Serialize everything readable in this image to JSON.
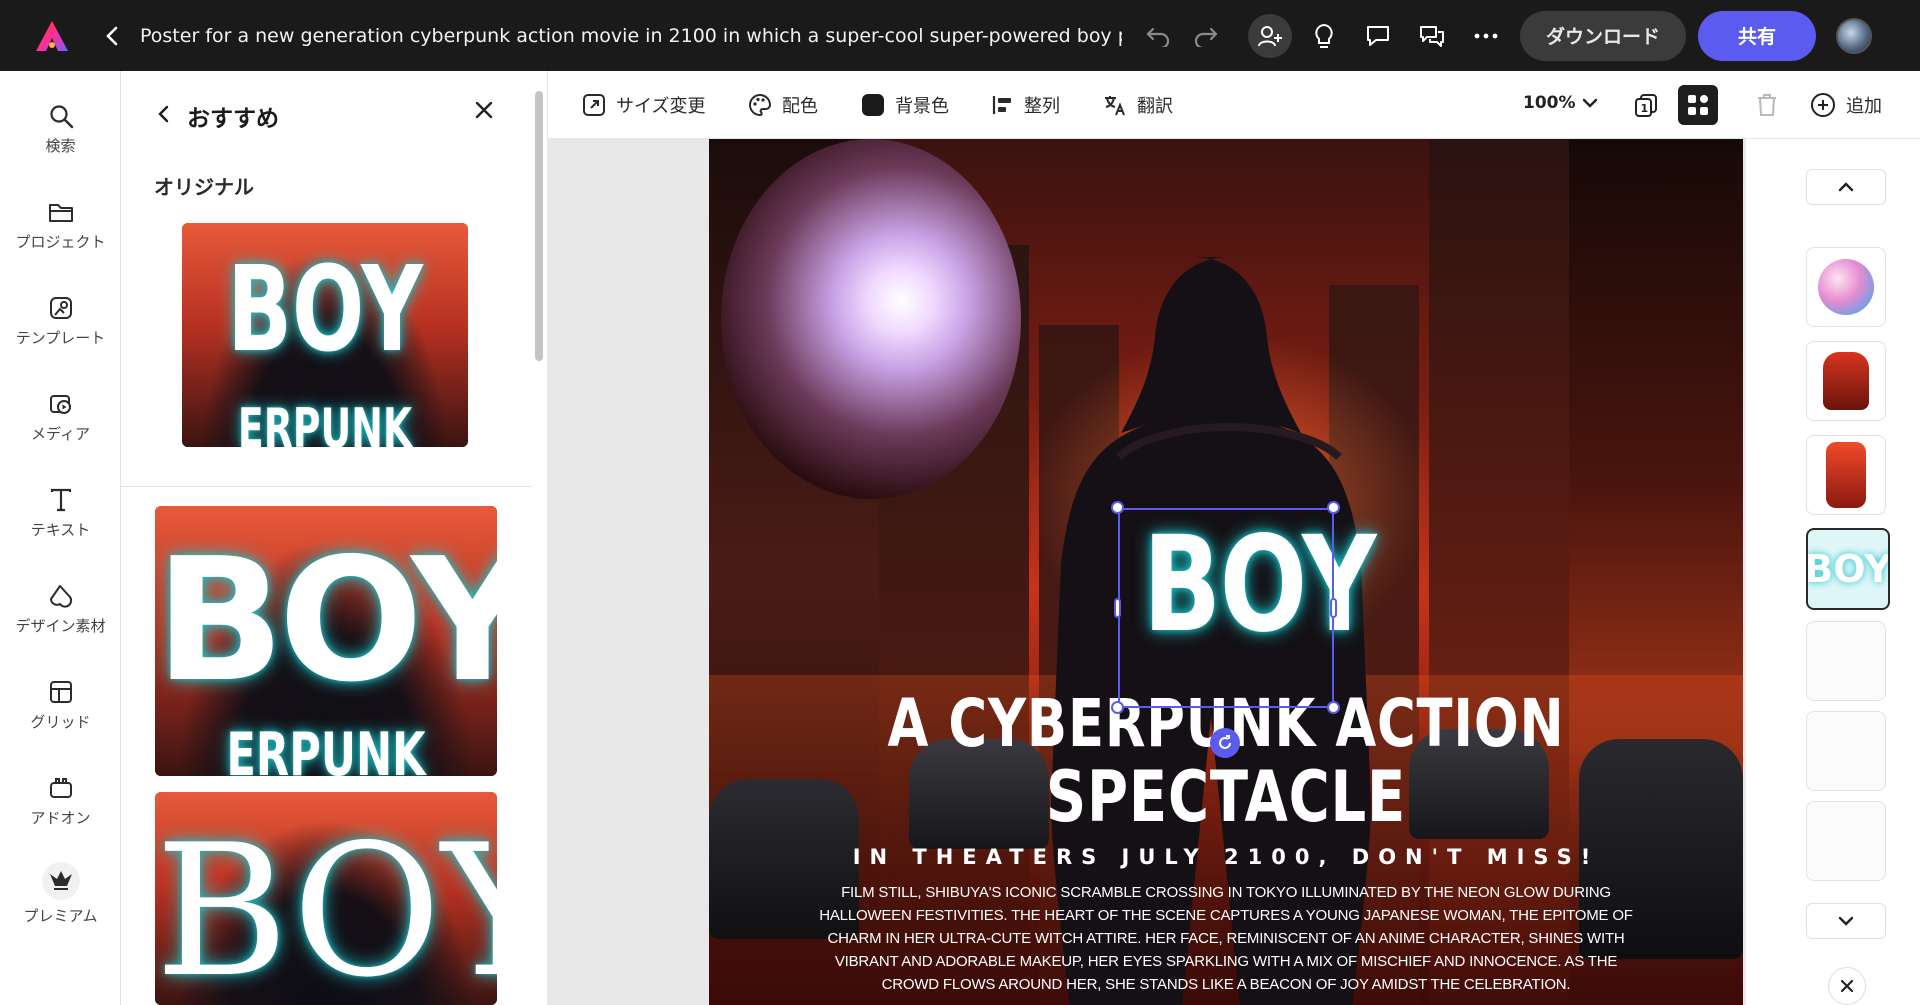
{
  "topbar": {
    "title": "Poster for a new generation cyberpunk action movie in 2100 in which a super-cool super-powered boy pla",
    "download_label": "ダウンロード",
    "share_label": "共有"
  },
  "rail": {
    "items": [
      {
        "label": "検索",
        "icon": "search-icon"
      },
      {
        "label": "プロジェクト",
        "icon": "folder-icon"
      },
      {
        "label": "テンプレート",
        "icon": "template-icon"
      },
      {
        "label": "メディア",
        "icon": "media-icon"
      },
      {
        "label": "テキスト",
        "icon": "text-icon"
      },
      {
        "label": "デザイン素材",
        "icon": "shapes-icon"
      },
      {
        "label": "グリッド",
        "icon": "grid-icon"
      },
      {
        "label": "アドオン",
        "icon": "addon-icon"
      },
      {
        "label": "プレミアム",
        "icon": "premium-crown-icon"
      }
    ]
  },
  "panel": {
    "title": "おすすめ",
    "section_label": "オリジナル",
    "thumbs": [
      {
        "word": "BOY",
        "sub": "ERPUNK AC"
      },
      {
        "word": "BOY",
        "sub": "ERPUNK AC"
      },
      {
        "word": "BOY"
      }
    ]
  },
  "toolbar": {
    "resize": "サイズ変更",
    "color": "配色",
    "background": "背景色",
    "align": "整列",
    "translate": "翻訳",
    "zoom": "100%",
    "add": "追加"
  },
  "poster": {
    "word": "BOY",
    "line1": "A CYBERPUNK ACTION",
    "line2": "SPECTACLE",
    "tagline": "IN THEATERS JULY 2100, DON'T MISS!",
    "body": "FILM STILL, SHIBUYA'S ICONIC SCRAMBLE CROSSING IN TOKYO ILLUMINATED BY THE NEON GLOW DURING HALLOWEEN FESTIVITIES. THE HEART OF THE SCENE CAPTURES A YOUNG JAPANESE WOMAN, THE EPITOME OF CHARM IN HER ULTRA-CUTE WITCH ATTIRE. HER FACE, REMINISCENT OF AN ANIME CHARACTER, SHINES WITH VIBRANT AND ADORABLE MAKEUP, HER EYES SPARKLING WITH A MIX OF MISCHIEF AND INNOCENCE. AS THE CROWD FLOWS AROUND HER, SHE STANDS LIKE A BEACON OF JOY AMIDST THE CELEBRATION."
  },
  "pages": {
    "selected_thumb_text": "BOY"
  },
  "colors": {
    "accent": "#5b5bf0",
    "topbar": "#1a1a1a",
    "neon_cyan": "#18c2c7"
  }
}
